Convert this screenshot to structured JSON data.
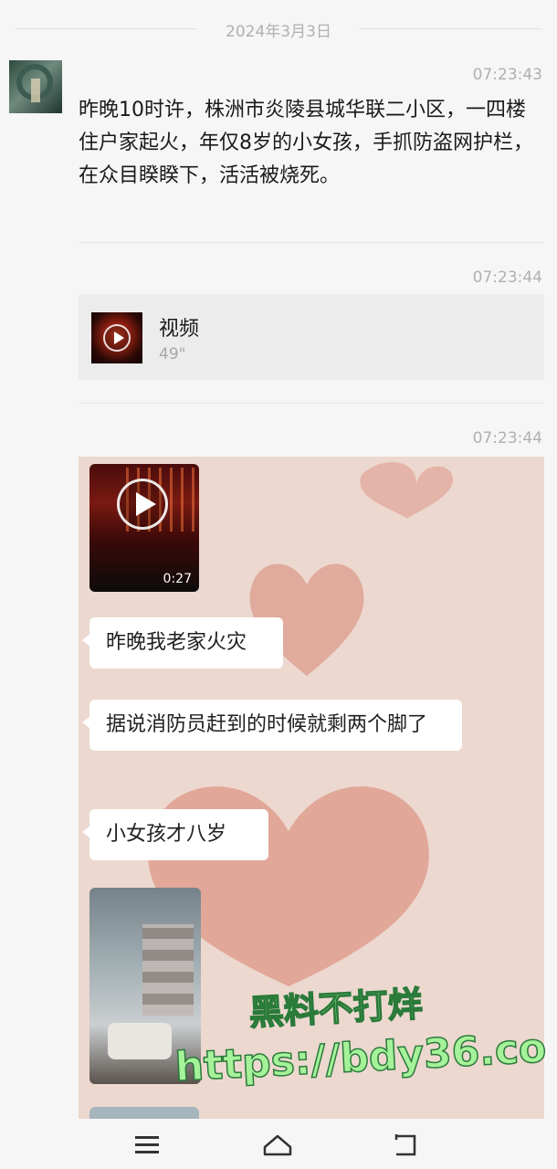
{
  "date_separator": "2024年3月3日",
  "messages": [
    {
      "time": "07:23:43",
      "text": "昨晚10时许，株洲市炎陵县城华联二小区，一四楼住户家起火，年仅8岁的小女孩，手抓防盗网护栏，在众目睽睽下，活活被烧死。"
    },
    {
      "time": "07:23:44",
      "video": {
        "title": "视频",
        "duration": "49\""
      }
    },
    {
      "time": "07:23:44",
      "screenshot": {
        "video_duration": "0:27",
        "bubbles": [
          "昨晚我老家火灾",
          "据说消防员赶到的时候就剩两个脚了",
          "小女孩才八岁"
        ]
      }
    }
  ],
  "watermark": {
    "line1": "黑料不打烊",
    "line2": "https://bdy36.co"
  },
  "navbar": {
    "icons": [
      "menu-icon",
      "home-icon",
      "back-icon"
    ]
  }
}
